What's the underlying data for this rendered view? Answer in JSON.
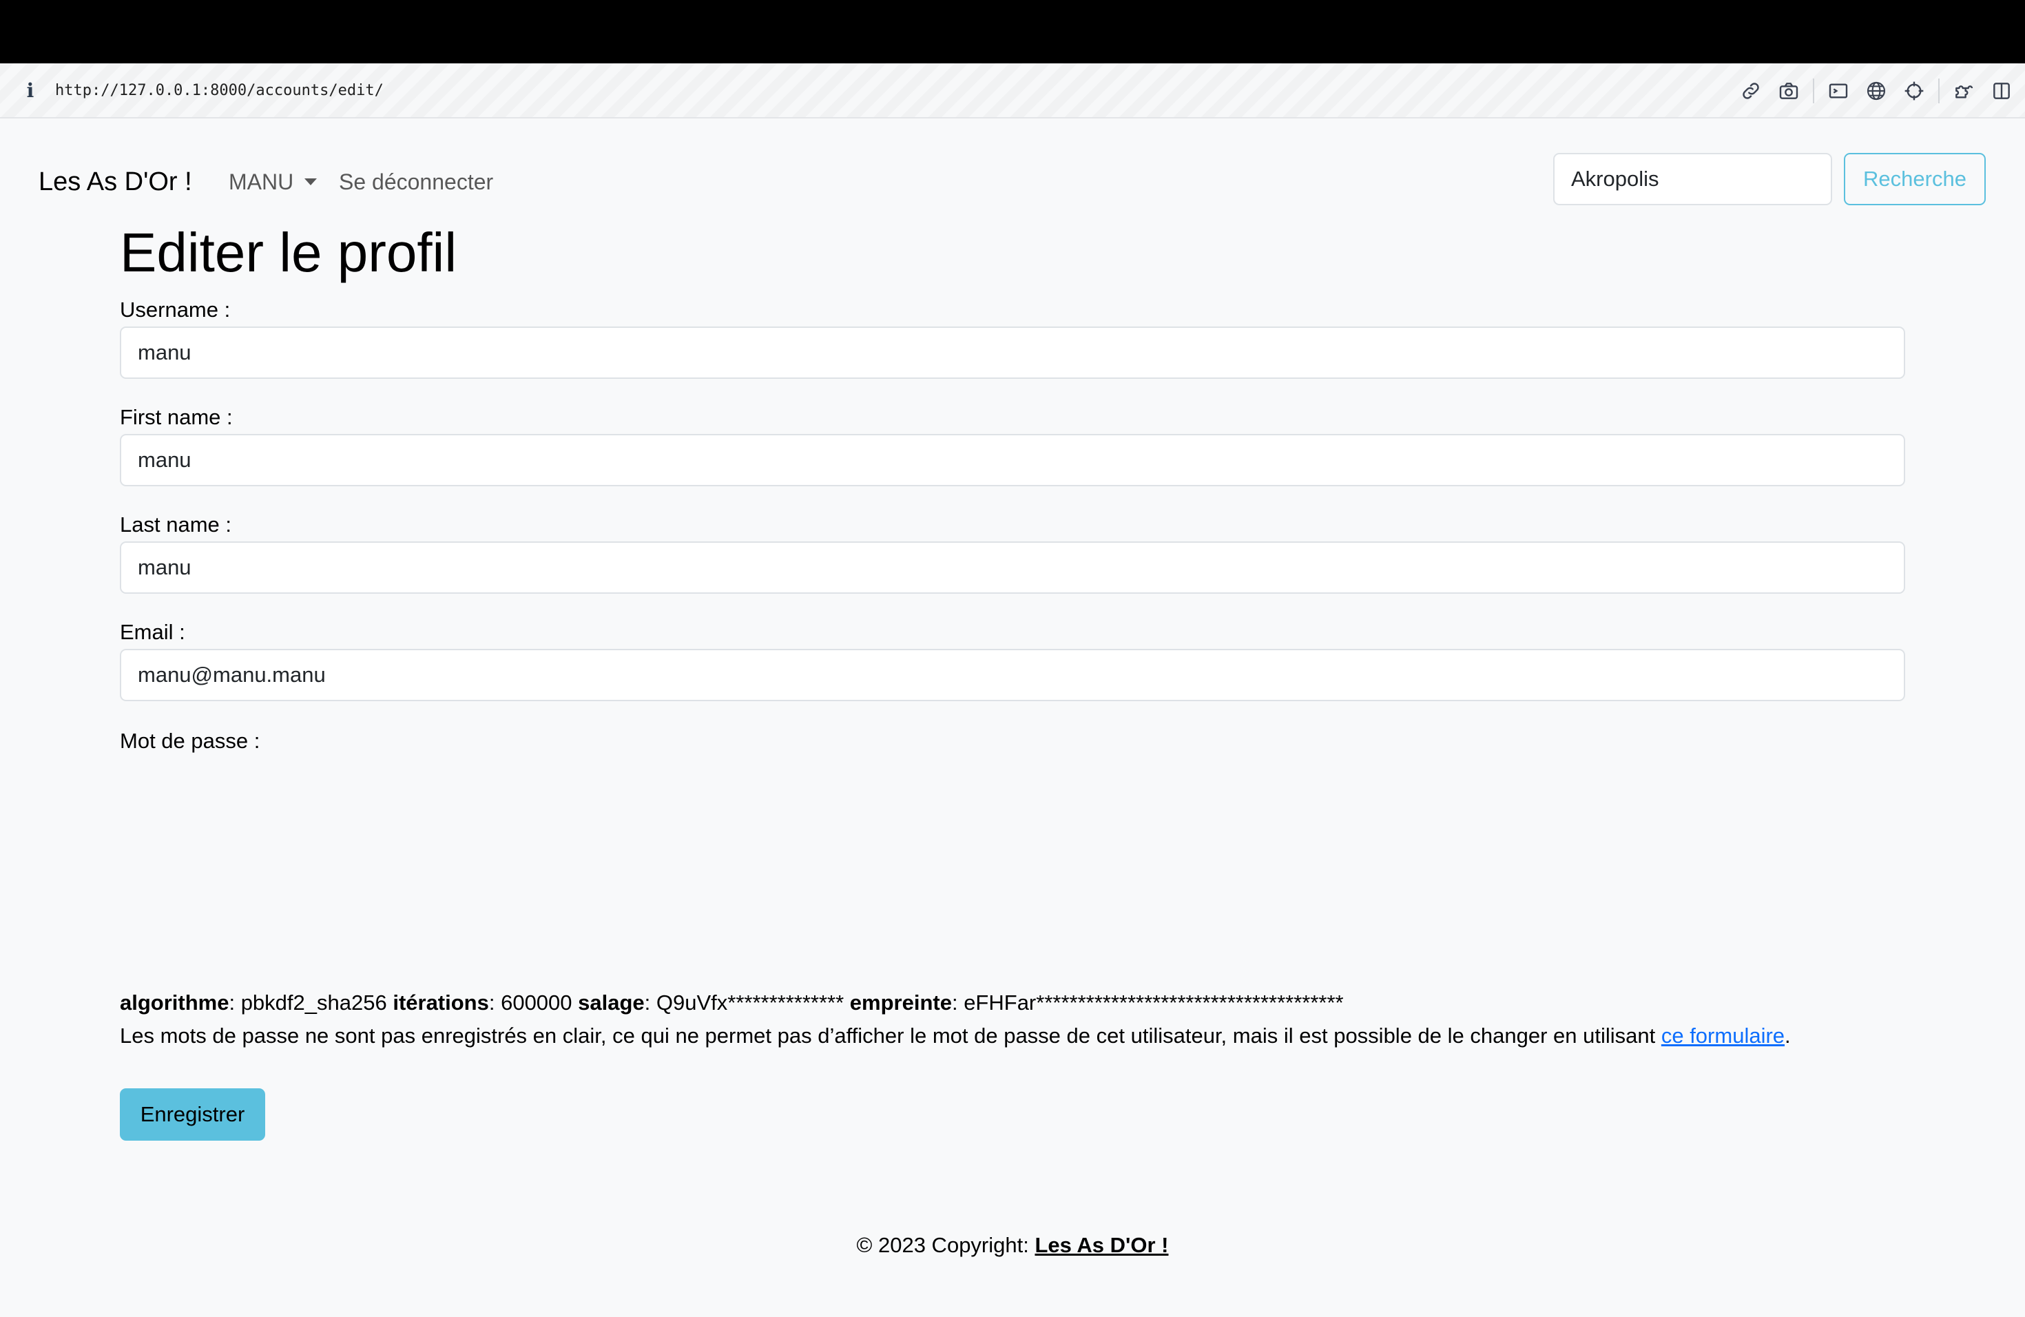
{
  "browser": {
    "url": "http://127.0.0.1:8000/accounts/edit/",
    "info_icon": "info-icon",
    "toolbar_icons": [
      "link-icon",
      "camera-icon",
      "terminal-icon",
      "globe-icon",
      "crosshair-icon",
      "extension-icon",
      "sidebar-icon"
    ]
  },
  "navbar": {
    "brand": "Les As D'Or !",
    "user_menu": "MANU",
    "logout": "Se déconnecter",
    "search_value": "Akropolis",
    "search_button": "Recherche"
  },
  "page": {
    "title": "Editer le profil",
    "fields": {
      "username": {
        "label": "Username :",
        "value": "manu"
      },
      "first_name": {
        "label": "First name :",
        "value": "manu"
      },
      "last_name": {
        "label": "Last name :",
        "value": "manu"
      },
      "email": {
        "label": "Email :",
        "value": "manu@manu.manu"
      }
    },
    "password": {
      "label": "Mot de passe :",
      "algorithm_label": "algorithme",
      "algorithm_value": ": pbkdf2_sha256 ",
      "iterations_label": "itérations",
      "iterations_value": ": 600000 ",
      "salt_label": "salage",
      "salt_value": ": Q9uVfx************** ",
      "hash_label": "empreinte",
      "hash_value": ": eFHFar*************************************",
      "help_text": "Les mots de passe ne sont pas enregistrés en clair, ce qui ne permet pas d’afficher le mot de passe de cet utilisateur, mais il est possible de le changer en utilisant ",
      "help_link": "ce formulaire",
      "help_end": "."
    },
    "save_button": "Enregistrer"
  },
  "footer": {
    "prefix": "© 2023 Copyright: ",
    "link": "Les As D'Or !"
  },
  "colors": {
    "accent": "#5bc0de",
    "link": "#0d6efd",
    "background": "#f8f9fa"
  }
}
